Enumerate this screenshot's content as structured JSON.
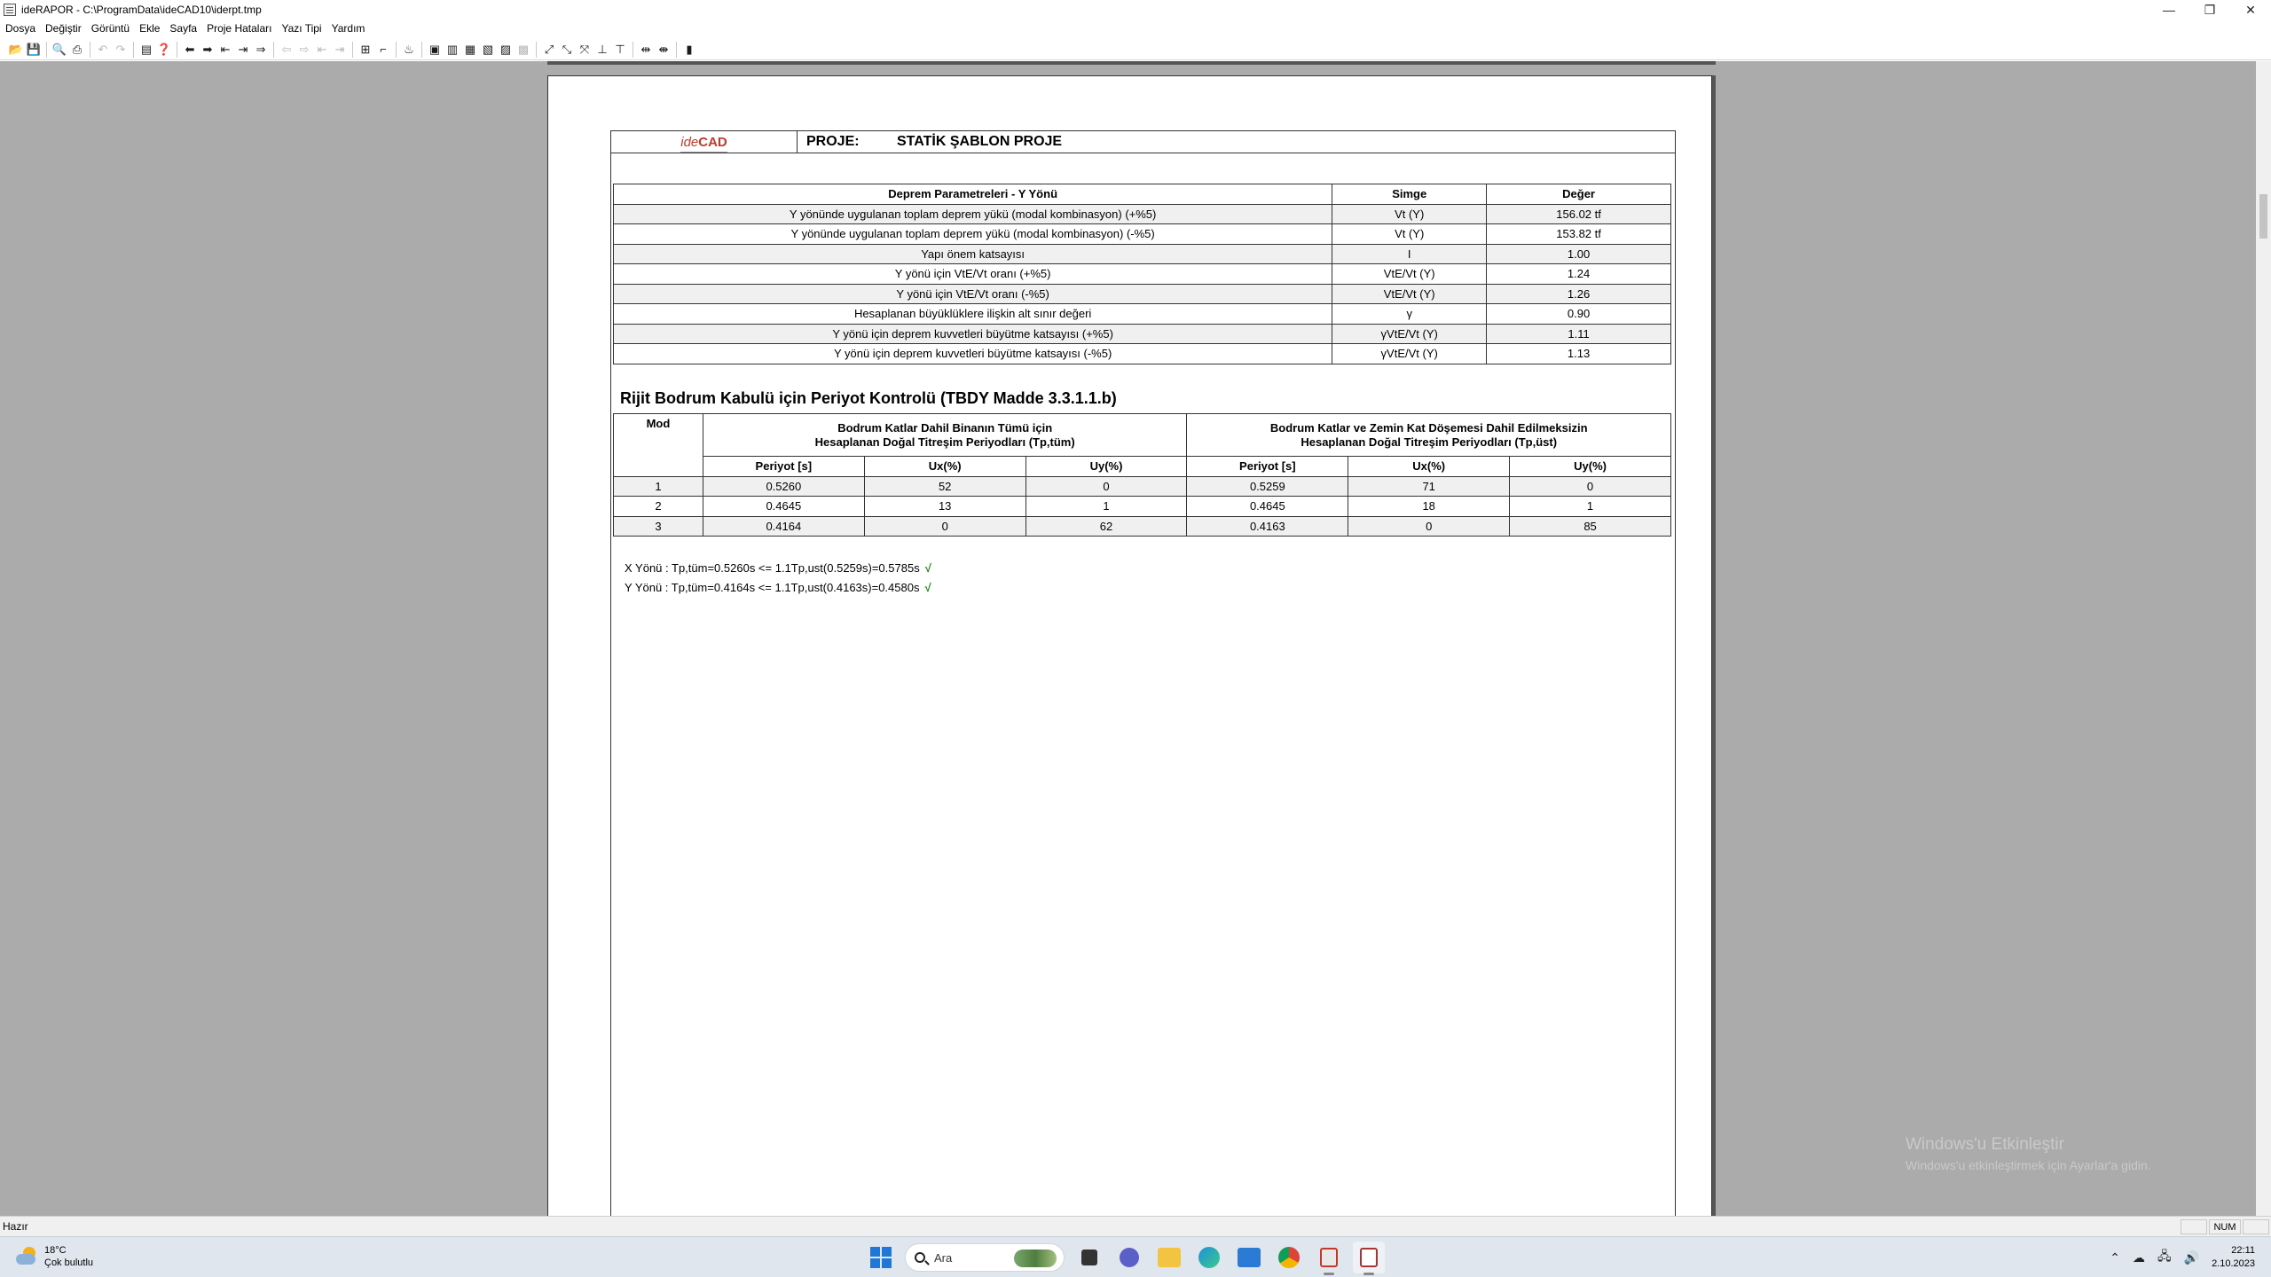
{
  "window": {
    "title": "ideRAPOR - C:\\ProgramData\\ideCAD10\\iderpt.tmp",
    "minimize_glyph": "—",
    "maximize_glyph": "❐",
    "close_glyph": "✕"
  },
  "menu": [
    "Dosya",
    "Değiştir",
    "Görüntü",
    "Ekle",
    "Sayfa",
    "Proje Hataları",
    "Yazı Tipi",
    "Yardım"
  ],
  "toolbar": {
    "icons": [
      "open-icon",
      "save-icon",
      "print-preview-icon",
      "print-icon",
      "undo-icon",
      "redo-icon",
      "page-icon",
      "help-icon",
      "arrow-left-icon",
      "arrow-right-icon",
      "first-icon",
      "last-icon",
      "find-icon",
      "prev-disabled-icon",
      "next-disabled-icon",
      "first-disabled-icon",
      "last-disabled-icon",
      "insert-icon",
      "break-icon",
      "chart-icon",
      "layout-icon",
      "col1-icon",
      "col2-icon",
      "col3-icon",
      "col4-icon",
      "col5-icon",
      "zoom-icon",
      "zoom2-icon",
      "zoom3-icon",
      "align-icon",
      "align2-icon",
      "fit-icon",
      "fitwidth-icon",
      "book-icon"
    ]
  },
  "document": {
    "logo_ide": "ide",
    "logo_cad": "CAD",
    "project_label": "PROJE:",
    "project_name": "STATİK ŞABLON PROJE",
    "eq_table": {
      "headers": [
        "Deprem Parametreleri - Y Yönü",
        "Simge",
        "Değer"
      ],
      "rows": [
        [
          "Y yönünde uygulanan toplam deprem yükü (modal kombinasyon) (+%5)",
          "Vt (Y)",
          "156.02 tf"
        ],
        [
          "Y yönünde uygulanan toplam deprem yükü (modal kombinasyon) (-%5)",
          "Vt (Y)",
          "153.82 tf"
        ],
        [
          "Yapı önem katsayısı",
          "I",
          "1.00"
        ],
        [
          "Y yönü için VtE/Vt oranı (+%5)",
          "VtE/Vt (Y)",
          "1.24"
        ],
        [
          "Y yönü için VtE/Vt oranı (-%5)",
          "VtE/Vt (Y)",
          "1.26"
        ],
        [
          "Hesaplanan büyüklüklere ilişkin alt sınır değeri",
          "γ",
          "0.90"
        ],
        [
          "Y yönü için deprem kuvvetleri büyütme katsayısı (+%5)",
          "γVtE/Vt (Y)",
          "1.11"
        ],
        [
          "Y yönü için deprem kuvvetleri büyütme katsayısı (-%5)",
          "γVtE/Vt (Y)",
          "1.13"
        ]
      ]
    },
    "section_title": "Rijit Bodrum Kabulü için Periyot Kontrolü (TBDY Madde 3.3.1.1.b)",
    "period_table": {
      "mod_header": "Mod",
      "group1_line1": "Bodrum Katlar Dahil Binanın Tümü için",
      "group1_line2": "Hesaplanan Doğal Titreşim Periyodları (Tp,tüm)",
      "group2_line1": "Bodrum Katlar ve Zemin Kat Döşemesi Dahil Edilmeksizin",
      "group2_line2": "Hesaplanan Doğal Titreşim Periyodları (Tp,üst)",
      "sub_headers": [
        "Periyot [s]",
        "Ux(%)",
        "Uy(%)",
        "Periyot [s]",
        "Ux(%)",
        "Uy(%)"
      ],
      "rows": [
        [
          "1",
          "0.5260",
          "52",
          "0",
          "0.5259",
          "71",
          "0"
        ],
        [
          "2",
          "0.4645",
          "13",
          "1",
          "0.4645",
          "18",
          "1"
        ],
        [
          "3",
          "0.4164",
          "0",
          "62",
          "0.4163",
          "0",
          "85"
        ]
      ]
    },
    "check_x": "X Yönü : Tp,tüm=0.5260s <= 1.1Tp,ust(0.5259s)=0.5785s",
    "check_y": "Y Yönü : Tp,tüm=0.4164s <= 1.1Tp,ust(0.4163s)=0.4580s",
    "check_mark": "√"
  },
  "watermark": {
    "line1": "Windows'u Etkinleştir",
    "line2": "Windows'u etkinleştirmek için Ayarlar'a gidin."
  },
  "status": {
    "text": "Hazır",
    "num": "NUM"
  },
  "taskbar": {
    "temp": "18°C",
    "weather": "Çok bulutlu",
    "search": "Ara",
    "time": "22:11",
    "date": "2.10.2023"
  }
}
